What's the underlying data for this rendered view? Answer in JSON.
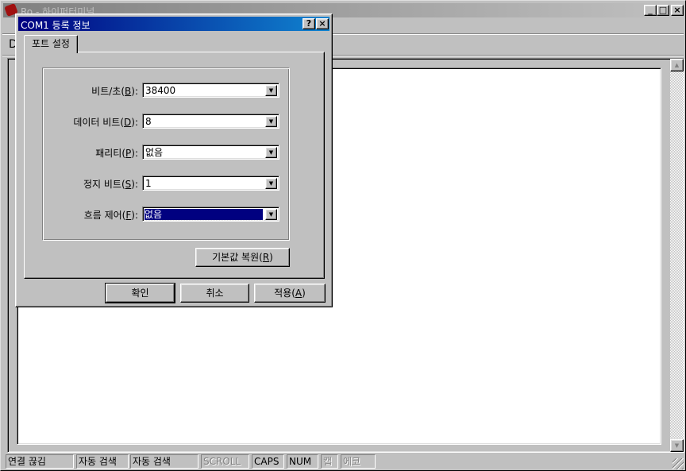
{
  "main_window": {
    "title": "Ro - 하이퍼터미널",
    "toolbar_partial": "D"
  },
  "dialog": {
    "title": "COM1 등록 정보",
    "tab": "포트 설정",
    "fields": [
      {
        "label": "비트/초(",
        "key": "B",
        "end": "):",
        "value": "38400"
      },
      {
        "label": "데이터 비트(",
        "key": "D",
        "end": "):",
        "value": "8"
      },
      {
        "label": "패리티(",
        "key": "P",
        "end": "):",
        "value": "없음"
      },
      {
        "label": "정지 비트(",
        "key": "S",
        "end": "):",
        "value": "1"
      },
      {
        "label": "흐름 제어(",
        "key": "F",
        "end": "):",
        "value": "없음"
      }
    ],
    "restore": {
      "label": "기본값 복원(",
      "key": "R",
      "end": ")"
    },
    "ok": "확인",
    "cancel": "취소",
    "apply": {
      "label": "적용(",
      "key": "A",
      "end": ")"
    },
    "help_icon": "?",
    "close_icon": "×"
  },
  "status_bar": [
    "연결 끊김",
    "자동 검색",
    "자동 검색",
    "SCROLL",
    "CAPS",
    "NUM",
    "캡",
    "에코"
  ],
  "colors": {
    "active_title": "#000080",
    "inactive_title": "#808080",
    "selection": "#000080"
  }
}
